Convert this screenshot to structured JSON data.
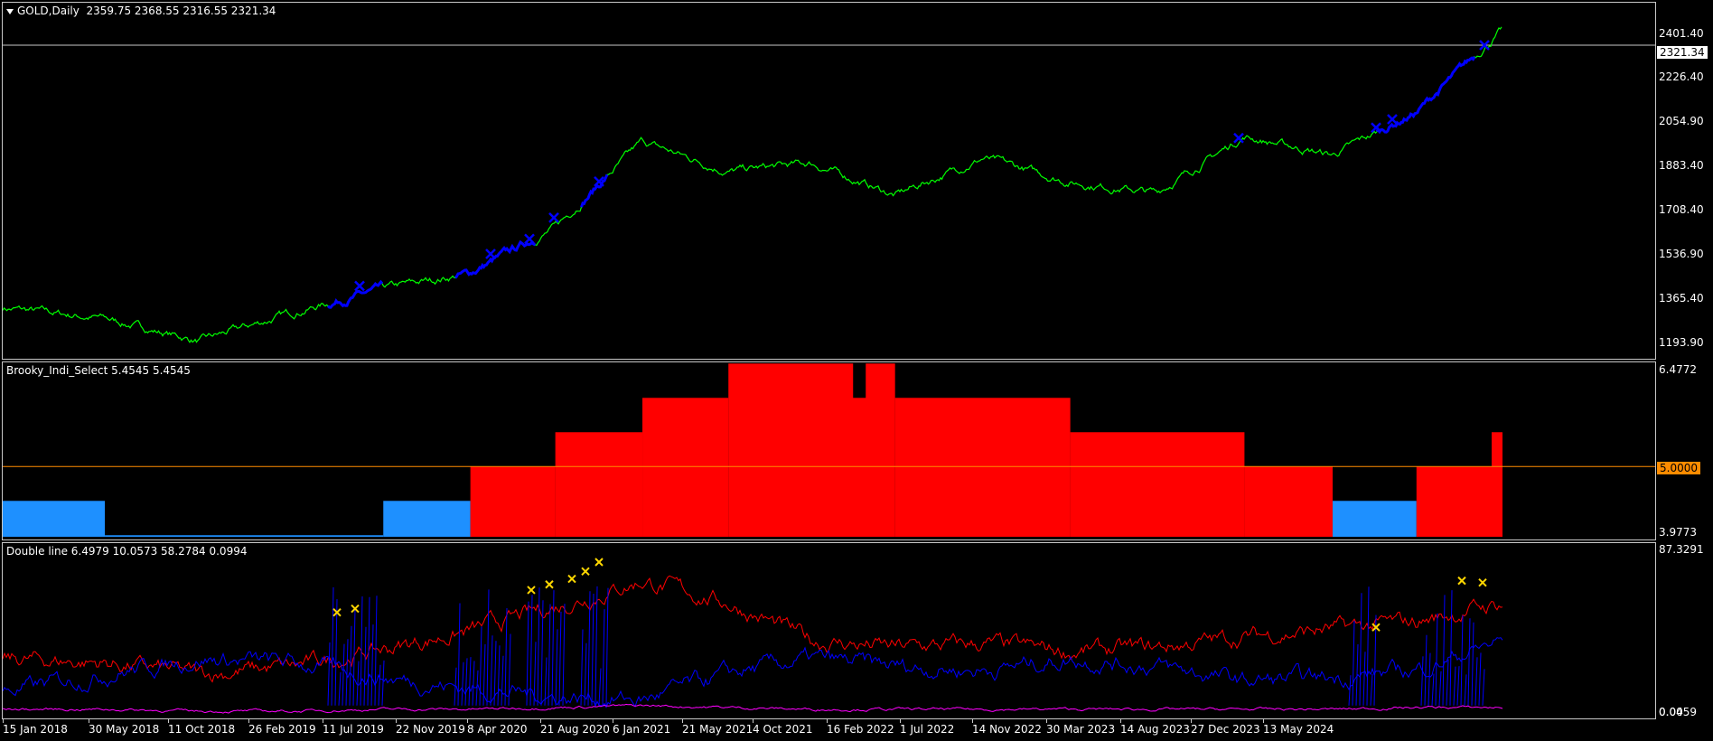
{
  "main_pane": {
    "title": "GOLD,Daily  2359.75 2368.55 2316.55 2321.34",
    "price_tag": "2321.34",
    "y_ticks": [
      "2401.40",
      "2226.40",
      "2054.90",
      "1883.40",
      "1708.40",
      "1536.90",
      "1365.40",
      "1193.90"
    ]
  },
  "indicator1": {
    "title": "Brooky_Indi_Select 5.4545 5.4545",
    "level_tag": "5.0000",
    "y_ticks": [
      "6.4772",
      "3.9773"
    ]
  },
  "indicator2": {
    "title": "Double line 6.4979 10.0573 58.2784 0.0994",
    "y_ticks": [
      "87.3291",
      "0.0459"
    ],
    "y_ticks_extra": "0.00"
  },
  "x_ticks": [
    "15 Jan 2018",
    "30 May 2018",
    "11 Oct 2018",
    "26 Feb 2019",
    "11 Jul 2019",
    "22 Nov 2019",
    "8 Apr 2020",
    "21 Aug 2020",
    "6 Jan 2021",
    "21 May 2021",
    "4 Oct 2021",
    "16 Feb 2022",
    "1 Jul 2022",
    "14 Nov 2022",
    "30 Mar 2023",
    "14 Aug 2023",
    "27 Dec 2023",
    "13 May 2024"
  ],
  "colors": {
    "background": "#000000",
    "price_line": "#00ff00",
    "signal_blue": "#0000ff",
    "bull_block": "#ff0000",
    "bear_block": "#1e90ff",
    "level_line": "#ff8c00",
    "line_red": "#ff0000",
    "line_blue": "#0000ff",
    "line_magenta": "#ff00ff",
    "marker": "#ffd700"
  },
  "chart_data": [
    {
      "type": "line",
      "title": "GOLD,Daily",
      "x": [
        "15 Jan 2018",
        "30 May 2018",
        "11 Oct 2018",
        "26 Feb 2019",
        "11 Jul 2019",
        "22 Nov 2019",
        "8 Apr 2020",
        "21 Aug 2020",
        "6 Jan 2021",
        "21 May 2021",
        "4 Oct 2021",
        "16 Feb 2022",
        "1 Jul 2022",
        "14 Nov 2022",
        "30 Mar 2023",
        "14 Aug 2023",
        "27 Dec 2023",
        "13 May 2024"
      ],
      "series": [
        {
          "values": [
            1340,
            1300,
            1215,
            1325,
            1410,
            1470,
            1640,
            1960,
            1850,
            1880,
            1760,
            1900,
            1810,
            1770,
            1980,
            1910,
            2070,
            2380
          ]
        }
      ],
      "ylim": [
        1150,
        2480
      ]
    },
    {
      "type": "bar",
      "title": "Brooky_Indi_Select",
      "segments": [
        {
          "from": "15 Jan 2018",
          "to": "30 May 2018",
          "value": 4.5,
          "color": "bear"
        },
        {
          "from": "30 May 2018",
          "to": "11 Jul 2019",
          "value": 4.0,
          "color": "bear"
        },
        {
          "from": "11 Jul 2019",
          "to": "22 Nov 2019",
          "value": 4.5,
          "color": "bear"
        },
        {
          "from": "22 Nov 2019",
          "to": "8 Apr 2020",
          "value": 5.0,
          "color": "bull"
        },
        {
          "from": "8 Apr 2020",
          "to": "21 Aug 2020",
          "value": 5.5,
          "color": "bull"
        },
        {
          "from": "21 Aug 2020",
          "to": "6 Jan 2021",
          "value": 6.0,
          "color": "bull"
        },
        {
          "from": "6 Jan 2021",
          "to": "4 Oct 2021",
          "value": 6.5,
          "color": "bull"
        },
        {
          "from": "4 Oct 2021",
          "to": "1 Jul 2022",
          "value": 6.0,
          "color": "bull"
        },
        {
          "from": "1 Jul 2022",
          "to": "30 Mar 2023",
          "value": 5.5,
          "color": "bull"
        },
        {
          "from": "30 Mar 2023",
          "to": "14 Aug 2023",
          "value": 5.0,
          "color": "bull"
        },
        {
          "from": "14 Aug 2023",
          "to": "27 Dec 2023",
          "value": 4.5,
          "color": "bear"
        },
        {
          "from": "27 Dec 2023",
          "to": "13 May 2024",
          "value": 5.0,
          "color": "bull"
        }
      ],
      "level": 5.0,
      "ylim": [
        3.9773,
        6.4772
      ]
    },
    {
      "type": "line",
      "title": "Double line",
      "series": [
        {
          "values": [
            30,
            28,
            22,
            26,
            35,
            45,
            58,
            72,
            60,
            40,
            36,
            38,
            34,
            36,
            42,
            46,
            50,
            60
          ]
        },
        {
          "values": [
            12,
            22,
            30,
            28,
            20,
            14,
            10,
            8,
            22,
            30,
            26,
            24,
            30,
            26,
            18,
            20,
            24,
            40
          ]
        },
        {
          "values": [
            3,
            3,
            2,
            2,
            3,
            3,
            4,
            5,
            4,
            3,
            3,
            3,
            3,
            3,
            3,
            3,
            4,
            4
          ]
        }
      ],
      "ylim": [
        0.0459,
        87.3291
      ]
    }
  ]
}
